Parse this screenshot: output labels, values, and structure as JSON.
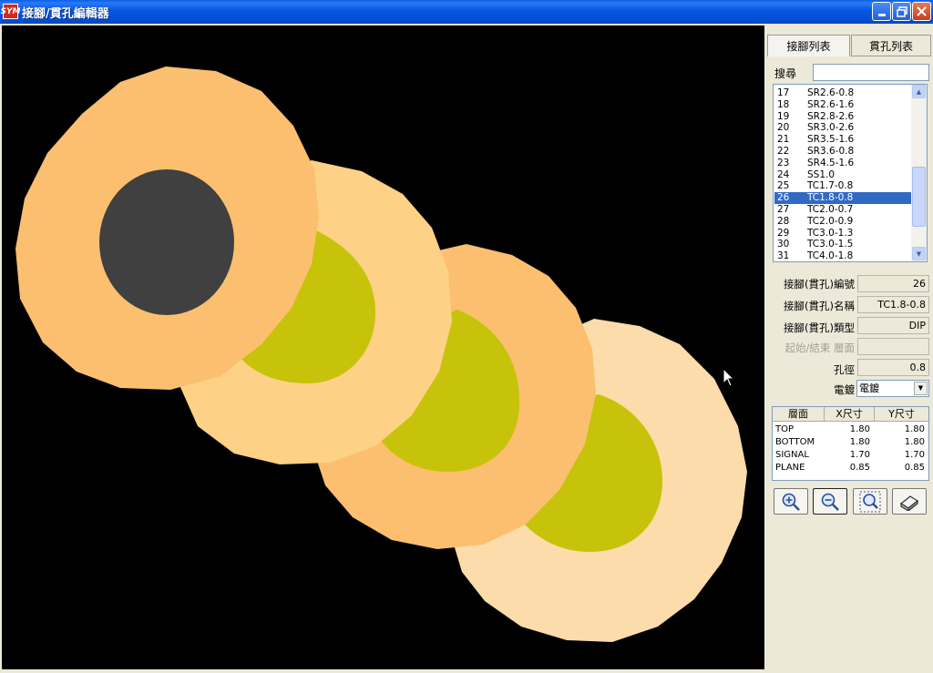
{
  "window": {
    "title": "接腳/貫孔編輯器",
    "icon_text": "SYM"
  },
  "tabs": [
    {
      "label": "接腳列表"
    },
    {
      "label": "貫孔列表"
    }
  ],
  "search": {
    "label": "搜尋",
    "value": ""
  },
  "pin_list": [
    {
      "num": "17",
      "name": "SR2.6-0.8"
    },
    {
      "num": "18",
      "name": "SR2.6-1.6"
    },
    {
      "num": "19",
      "name": "SR2.8-2.6"
    },
    {
      "num": "20",
      "name": "SR3.0-2.6"
    },
    {
      "num": "21",
      "name": "SR3.5-1.6"
    },
    {
      "num": "22",
      "name": "SR3.6-0.8"
    },
    {
      "num": "23",
      "name": "SR4.5-1.6"
    },
    {
      "num": "24",
      "name": "SS1.0"
    },
    {
      "num": "25",
      "name": "TC1.7-0.8"
    },
    {
      "num": "26",
      "name": "TC1.8-0.8",
      "selected": true
    },
    {
      "num": "27",
      "name": "TC2.0-0.7"
    },
    {
      "num": "28",
      "name": "TC2.0-0.9"
    },
    {
      "num": "29",
      "name": "TC3.0-1.3"
    },
    {
      "num": "30",
      "name": "TC3.0-1.5"
    },
    {
      "num": "31",
      "name": "TC4.0-1.8"
    }
  ],
  "properties": {
    "id_label": "接腳(貫孔)編號",
    "id_value": "26",
    "name_label": "接腳(貫孔)名稱",
    "name_value": "TC1.8-0.8",
    "type_label": "接腳(貫孔)類型",
    "type_value": "DIP",
    "layers_label": "起始/結束 層面",
    "layers_value": "",
    "hole_label": "孔徑",
    "hole_value": "0.8",
    "plating_label": "電鍍",
    "plating_value": "電鍍"
  },
  "layer_table": {
    "headers": [
      "層面",
      "X尺寸",
      "Y尺寸"
    ],
    "rows": [
      {
        "layer": "TOP",
        "x": "1.80",
        "y": "1.80"
      },
      {
        "layer": "BOTTOM",
        "x": "1.80",
        "y": "1.80"
      },
      {
        "layer": "SIGNAL",
        "x": "1.70",
        "y": "1.70"
      },
      {
        "layer": "PLANE",
        "x": "0.85",
        "y": "0.85"
      }
    ]
  },
  "tools": [
    {
      "icon": "zoom-in-icon"
    },
    {
      "icon": "zoom-out-icon"
    },
    {
      "icon": "zoom-fit-icon"
    },
    {
      "icon": "eraser-icon"
    }
  ],
  "colors": {
    "canvas_bg": "#000000",
    "pad_top": "#fbbf6f",
    "pad_bottom": "#fdd186",
    "pad_signal": "#fbbf6f",
    "pad_plane": "#fbdcaa",
    "drill_hole": "#404040",
    "inner_mark": "#c7c30a",
    "selection": "#316ac5"
  }
}
